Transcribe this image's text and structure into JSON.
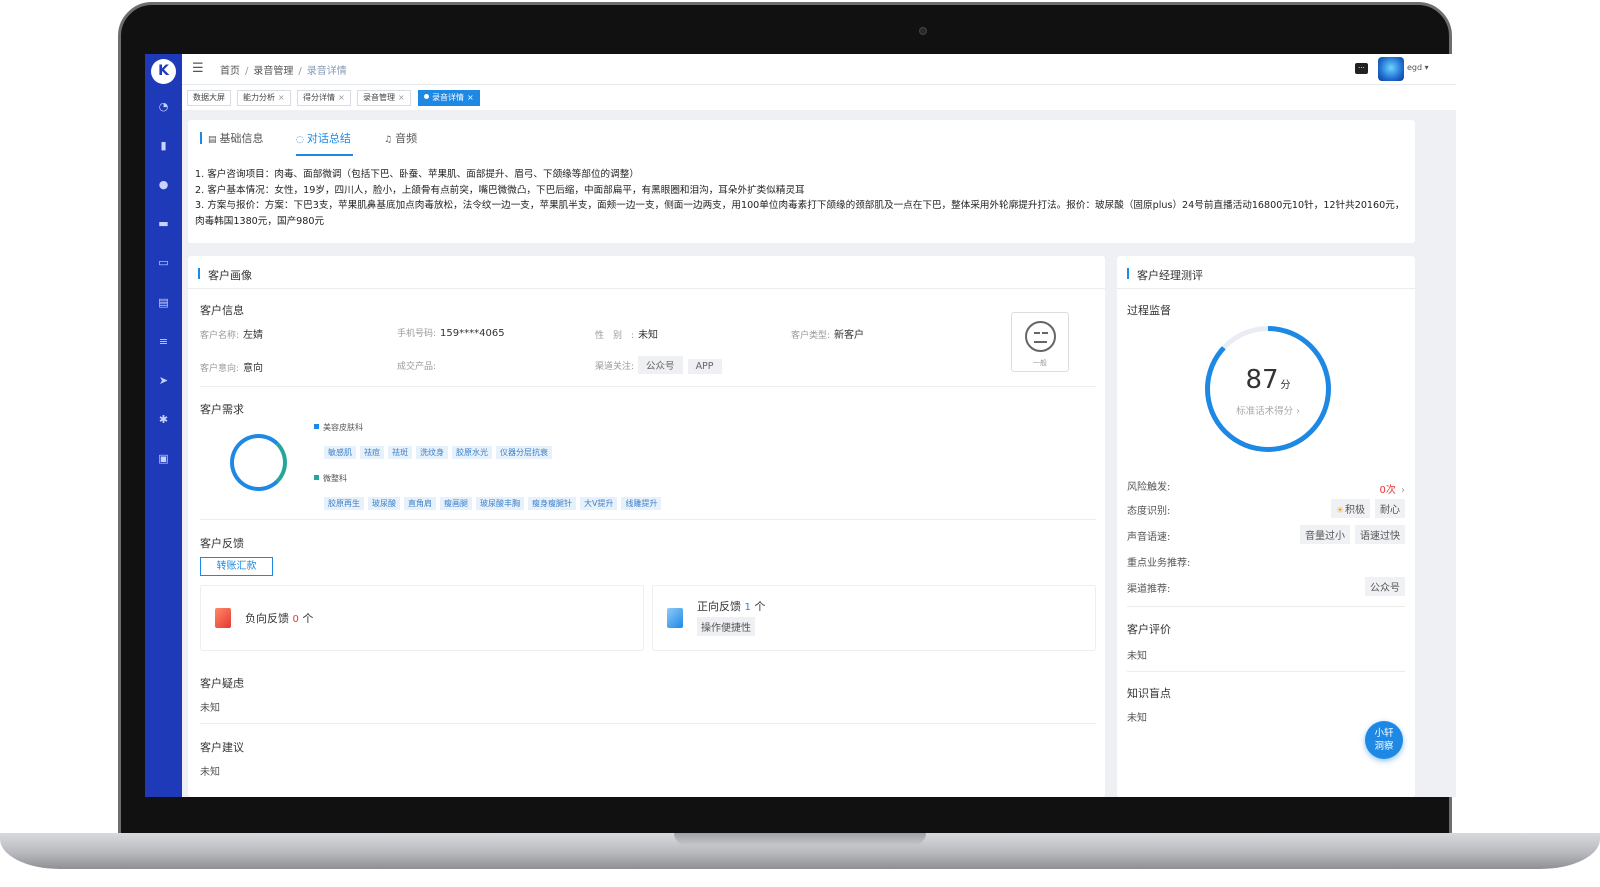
{
  "app": {
    "logo_glyph": "K",
    "user_name": "egd ▾",
    "accent_color": "#1e88e5",
    "sidebar_color": "#1e3ab8"
  },
  "sidebar": {
    "icons": [
      "dashboard-icon",
      "bar-chart-icon",
      "user-icon",
      "car-icon",
      "card-icon",
      "document-icon",
      "list-icon",
      "send-icon",
      "gear-icon",
      "monitor-icon"
    ]
  },
  "breadcrumb": {
    "items": [
      "首页",
      "录音管理",
      "录音详情"
    ],
    "separator": "/"
  },
  "page_tabs": [
    {
      "label": "数据大屏",
      "closable": false
    },
    {
      "label": "能力分析",
      "closable": true
    },
    {
      "label": "得分详情",
      "closable": true
    },
    {
      "label": "录音管理",
      "closable": true
    },
    {
      "label": "录音详情",
      "closable": true,
      "active": true
    }
  ],
  "content_tabs": [
    {
      "label": "基础信息",
      "icon": "database-icon"
    },
    {
      "label": "对话总结",
      "icon": "chat-icon",
      "active": true
    },
    {
      "label": "音频",
      "icon": "headphones-icon"
    }
  ],
  "summary": {
    "line1": "1. 客户咨询项目：肉毒、面部微调（包括下巴、卧蚕、苹果肌、面部提升、眉弓、下颌缘等部位的调整）",
    "line2": "2. 客户基本情况：女性，19岁，四川人，脸小，上颌骨有点前突，嘴巴微微凸，下巴后缩，中面部扁平，有黑眼圈和泪沟，耳朵外扩类似精灵耳",
    "line3": "3. 方案与报价：方案：下巴3支，苹果肌鼻基底加点肉毒放松，法令纹一边一支，苹果肌半支，面颊一边一支，侧面一边两支，用100单位肉毒素打下颌缘的颈部肌及一点在下巴，整体采用外轮廓提升打法。报价：玻尿酸（固原plus）24号前直播活动16800元10针，12针共20160元，肉毒韩国1380元，国产980元"
  },
  "portrait": {
    "title": "客户画像",
    "info": {
      "title": "客户信息",
      "name_label": "客户名称:",
      "name": "左婧",
      "phone_label": "手机号码:",
      "phone": "159****4065",
      "gender_label": "性　别　:",
      "gender": "未知",
      "type_label": "客户类型:",
      "type": "新客户",
      "intent_label": "客户意向:",
      "intent": "意向",
      "product_label": "成交产品:",
      "product": "",
      "channel_label": "渠道关注:",
      "channels": [
        "公众号",
        "APP"
      ],
      "emotion": "一般"
    },
    "needs": {
      "title": "客户需求",
      "categories": [
        {
          "name": "美容皮肤科",
          "color": "#1e88e5",
          "tags": [
            "敏感肌",
            "祛痘",
            "祛斑",
            "洗纹身",
            "胶原水光",
            "仪器分层抗衰"
          ]
        },
        {
          "name": "微整科",
          "color": "#26a69a",
          "tags": [
            "胶原再生",
            "玻尿酸",
            "直角肩",
            "瘦画腿",
            "玻尿酸丰胸",
            "瘦身瘦腿针",
            "大V提升",
            "线雕提升"
          ]
        }
      ]
    },
    "feedback": {
      "title": "客户反馈",
      "tag": "转账汇款",
      "negative_label": "负向反馈",
      "negative_count": "0",
      "negative_unit": "个",
      "positive_label": "正向反馈",
      "positive_count": "1",
      "positive_unit": "个",
      "positive_items": [
        "操作便捷性"
      ]
    },
    "concerns": {
      "title": "客户疑虑",
      "value": "未知"
    },
    "suggestions": {
      "title": "客户建议",
      "value": "未知"
    }
  },
  "review": {
    "title": "客户经理测评",
    "process_title": "过程监督",
    "score": "87",
    "score_unit": "分",
    "score_fraction": 0.87,
    "score_caption": "标准话术得分 ›",
    "risk_label": "风险触发:",
    "risk_value": "0次",
    "attitude_label": "态度识别:",
    "attitude_tags": [
      "积极",
      "耐心"
    ],
    "voice_label": "声音语速:",
    "voice_tags": [
      "音量过小",
      "语速过快"
    ],
    "business_label": "重点业务推荐:",
    "channel_label": "渠道推荐:",
    "channel_tags": [
      "公众号"
    ],
    "evaluation_title": "客户评价",
    "evaluation_value": "未知",
    "knowledge_title": "知识盲点",
    "knowledge_value": "未知"
  },
  "assistant": {
    "line1": "小轩",
    "line2": "洞察"
  }
}
